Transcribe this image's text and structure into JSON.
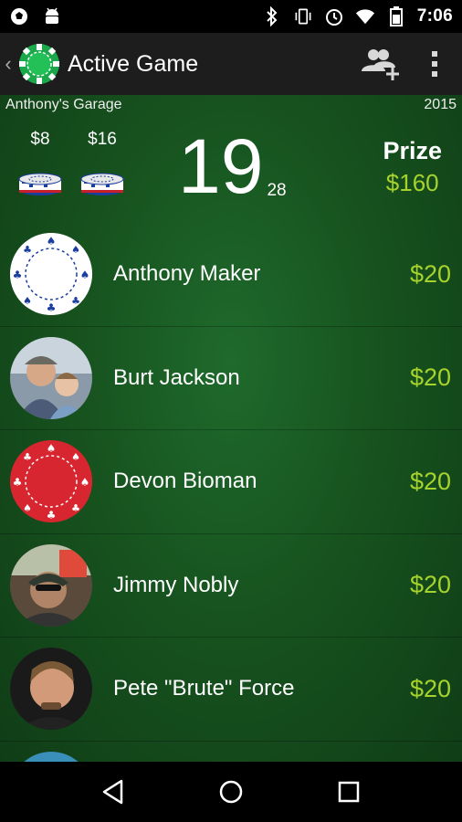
{
  "status_bar": {
    "time": "7:06",
    "left_icons": [
      "soccer-ball-icon",
      "android-icon"
    ],
    "right_icons": [
      "bluetooth-icon",
      "vibrate-icon",
      "alarm-icon",
      "wifi-icon",
      "battery-icon"
    ]
  },
  "action_bar": {
    "title": "Active Game",
    "actions": [
      "add-player-icon",
      "overflow-menu-icon"
    ]
  },
  "game": {
    "venue": "Anthony's Garage",
    "year": "2015",
    "blinds": [
      {
        "label": "$8"
      },
      {
        "label": "$16"
      }
    ],
    "level_number": "19",
    "level_sub": "28",
    "prize_label": "Prize",
    "prize_value": "$160"
  },
  "players": [
    {
      "name": "Anthony Maker",
      "buyin": "$20",
      "avatar": "white-chip"
    },
    {
      "name": "Burt Jackson",
      "buyin": "$20",
      "avatar": "photo"
    },
    {
      "name": "Devon Bioman",
      "buyin": "$20",
      "avatar": "red-chip"
    },
    {
      "name": "Jimmy Nobly",
      "buyin": "$20",
      "avatar": "photo"
    },
    {
      "name": "Pete \"Brute\" Force",
      "buyin": "$20",
      "avatar": "photo"
    }
  ],
  "colors": {
    "accent_green_text": "#a5d22d",
    "felt": "#17531f",
    "action_bar": "#1d1d1d"
  },
  "nav_bar": [
    "back-icon",
    "home-icon",
    "recents-icon"
  ]
}
